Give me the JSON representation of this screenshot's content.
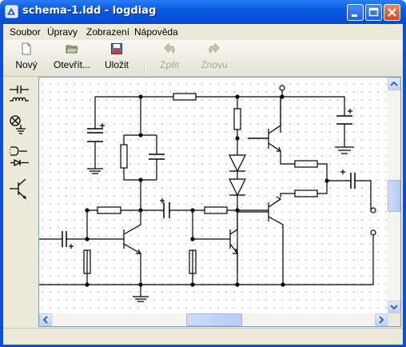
{
  "window": {
    "title": "schema-1.ldd - logdiag"
  },
  "menu": [
    "Soubor",
    "Úpravy",
    "Zobrazení",
    "Nápověda"
  ],
  "toolbar": {
    "new_label": "Nový",
    "open_label": "Otevřít...",
    "save_label": "Uložit",
    "undo_label": "Zpět",
    "redo_label": "Znovu"
  },
  "palette": [
    "capacitor-inductor-icon",
    "lamp-ground-icon",
    "plug-diode-icon",
    "transistor-icon"
  ],
  "colors": {
    "titlebar": "#0a50d8",
    "chrome": "#ece9d8",
    "wire": "#000000",
    "disabled_text": "#a8a69a"
  }
}
